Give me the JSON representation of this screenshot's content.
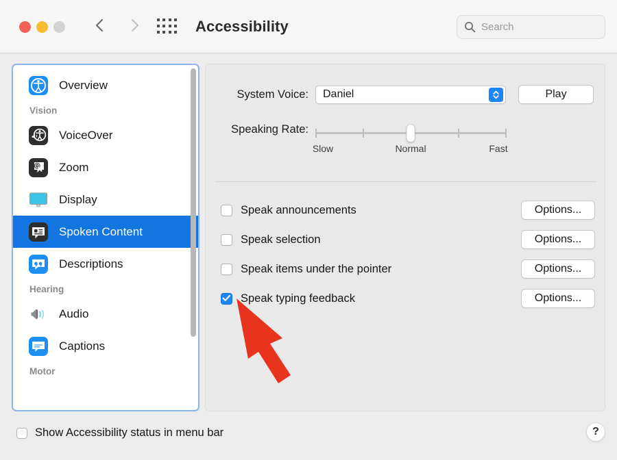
{
  "window": {
    "title": "Accessibility",
    "traffic_lights": [
      "close-red",
      "minimize-yellow",
      "zoom-disabled-gray"
    ],
    "back_icon": "chevron-left-icon",
    "forward_icon": "chevron-right-icon",
    "grid_icon": "all-preferences-grid-icon"
  },
  "search": {
    "placeholder": "Search",
    "value": "",
    "icon": "search-icon"
  },
  "sidebar": {
    "items": [
      {
        "type": "item",
        "label": "Overview",
        "icon": "accessibility-person-icon",
        "selected": false
      },
      {
        "type": "header",
        "label": "Vision"
      },
      {
        "type": "item",
        "label": "VoiceOver",
        "icon": "voiceover-icon",
        "selected": false
      },
      {
        "type": "item",
        "label": "Zoom",
        "icon": "zoom-magnifier-icon",
        "selected": false
      },
      {
        "type": "item",
        "label": "Display",
        "icon": "display-monitor-icon",
        "selected": false
      },
      {
        "type": "item",
        "label": "Spoken Content",
        "icon": "spoken-content-icon",
        "selected": true
      },
      {
        "type": "item",
        "label": "Descriptions",
        "icon": "descriptions-quote-icon",
        "selected": false
      },
      {
        "type": "header",
        "label": "Hearing"
      },
      {
        "type": "item",
        "label": "Audio",
        "icon": "audio-speaker-icon",
        "selected": false
      },
      {
        "type": "item",
        "label": "Captions",
        "icon": "captions-icon",
        "selected": false
      },
      {
        "type": "header",
        "label": "Motor"
      }
    ],
    "scrollbar": {
      "visible": true
    }
  },
  "main": {
    "system_voice": {
      "label": "System Voice:",
      "value": "Daniel",
      "stepper_icon": "chevron-up-down-icon",
      "play_label": "Play"
    },
    "speaking_rate": {
      "label": "Speaking Rate:",
      "value_percent": 50,
      "captions": [
        "Slow",
        "Normal",
        "Fast"
      ],
      "tick_percents": [
        0,
        25,
        75,
        100
      ]
    },
    "checkboxes": [
      {
        "label": "Speak announcements",
        "checked": false,
        "button": "Options..."
      },
      {
        "label": "Speak selection",
        "checked": false,
        "button": "Options..."
      },
      {
        "label": "Speak items under the pointer",
        "checked": false,
        "button": "Options..."
      },
      {
        "label": "Speak typing feedback",
        "checked": true,
        "button": "Options..."
      }
    ]
  },
  "bottom": {
    "menu_bar_checkbox": {
      "label": "Show Accessibility status in menu bar",
      "checked": false
    },
    "help_label": "?"
  },
  "annotation": {
    "type": "arrow",
    "color": "#e8341f",
    "points_to": "Speak typing feedback"
  },
  "colors": {
    "accent_blue": "#1275e0",
    "control_blue": "#1e86f0",
    "focus_ring": "#8cb4f0",
    "window_bg": "#ececec",
    "panel_bg": "#e9e9e9",
    "annotation_red": "#e8341f"
  }
}
